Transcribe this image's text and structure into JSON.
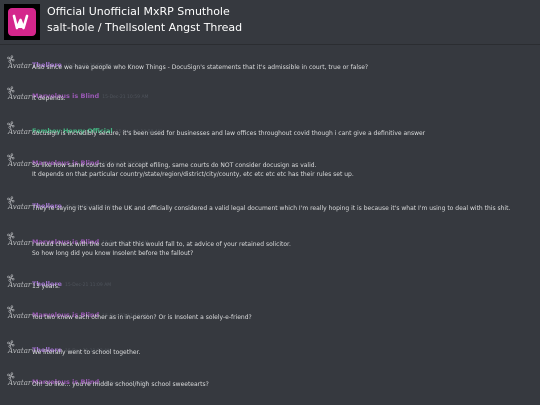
{
  "header": {
    "server_name": "Official Unofficial MxRP Smuthole",
    "channel_path": "salt-hole / Thellsolent Angst Thread",
    "brand_color": "#d4268c"
  },
  "avatar_label": "Avatar",
  "colors": {
    "Thellere": "#a173ce",
    "Marvelous is Blind": "#9b59b6",
    "Femboy Henry Official": "#43b581"
  },
  "messages": [
    {
      "author": "Thellere",
      "timestamp": "15-Dec-21 10:53 AM",
      "lines": [
        "Also since we have people who Know Things - DocuSign's statements that it's admissible in court, true or false?"
      ]
    },
    {
      "author": "Marvelous is Blind",
      "timestamp": "15-Dec-21 10:59 AM",
      "lines": [
        "It depends."
      ]
    },
    {
      "author": "Femboy Henry Official",
      "timestamp": "15-Dec-21 10:59 AM",
      "lines": [
        "docusign is incredibly secure, it's been used for businesses and law offices throughout covid though i cant give a definitive answer"
      ]
    },
    {
      "author": "Marvelous is Blind",
      "timestamp": "15-Dec-21 10:59 AM",
      "lines": [
        "So like how same courts do not accept efiling, same courts do NOT consider docusign as valid.",
        "It depends on that particular country/state/region/district/city/county, etc etc etc etc has their rules set up."
      ]
    },
    {
      "author": "Thellere",
      "timestamp": "15-Dec-21 11:01 AM",
      "lines": [
        "They're saying it's valid in the UK and officially considered a valid legal document which I'm really hoping it is because it's what I'm using to deal with this shit."
      ]
    },
    {
      "author": "Marvelous is Blind",
      "timestamp": "15-Dec-21 11:03 AM",
      "lines": [
        "I would check with the court that this would fall to, at advice of your retained solicitor.",
        "So how long did you know Insolent before the fallout?"
      ]
    },
    {
      "author": "Thellere",
      "timestamp": "15-Dec-21 11:09 AM",
      "lines": [
        "13 years."
      ]
    },
    {
      "author": "Marvelous is Blind",
      "timestamp": "15-Dec-21 11:10 AM",
      "lines": [
        "You two knew each other as in in-person? Or is Insolent a solely-e-friend?"
      ]
    },
    {
      "author": "Thellere",
      "timestamp": "15-Dec-21 11:13 AM",
      "lines": [
        "We literally went to school together."
      ]
    },
    {
      "author": "Marvelous is Blind",
      "timestamp": "15-Dec-21 11:16 AM",
      "lines": [
        "Oh! So like... you're middle school/high school sweetearts?"
      ]
    }
  ]
}
